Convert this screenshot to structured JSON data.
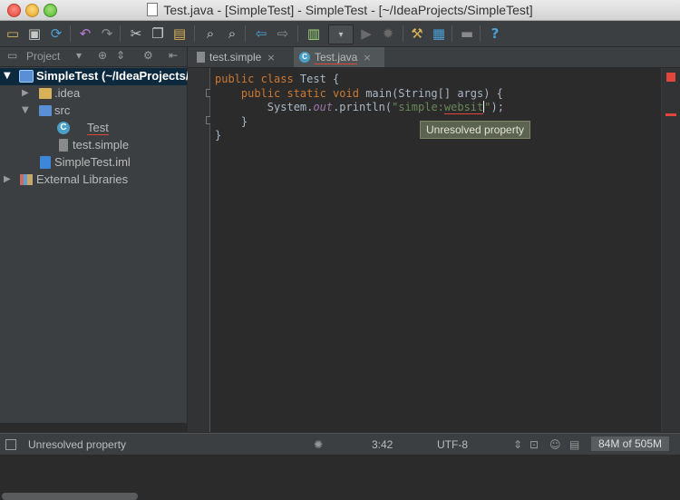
{
  "window": {
    "title": "Test.java - [SimpleTest] - SimpleTest - [~/IdeaProjects/SimpleTest]"
  },
  "toolbar": {
    "icons": [
      "open-folder-icon",
      "save-icon",
      "sync-icon",
      "back-icon",
      "forward-icon",
      "cut-icon",
      "copy-icon",
      "paste-icon",
      "find-icon",
      "replace-icon",
      "navigate-back-icon",
      "navigate-forward-icon",
      "make-icon",
      "run-config-dropdown",
      "run-icon",
      "debug-icon",
      "settings-icon",
      "project-structure-icon",
      "sdk-icon",
      "help-icon"
    ]
  },
  "project_panel": {
    "label": "Project",
    "tree": [
      {
        "label": "SimpleTest (~/IdeaProjects/",
        "icon": "module-folder-icon",
        "expanded": true,
        "selected": true
      },
      {
        "label": ".idea",
        "icon": "folder-icon",
        "expanded": false
      },
      {
        "label": "src",
        "icon": "source-folder-icon",
        "expanded": true
      },
      {
        "label": "Test",
        "icon": "class-icon"
      },
      {
        "label": "test.simple",
        "icon": "file-icon"
      },
      {
        "label": "SimpleTest.iml",
        "icon": "iml-icon"
      },
      {
        "label": "External Libraries",
        "icon": "library-icon",
        "expanded": false
      }
    ]
  },
  "editor_tabs": [
    {
      "label": "test.simple",
      "active": false,
      "close": "×"
    },
    {
      "label": "Test.java",
      "active": true,
      "close": "×"
    }
  ],
  "code": {
    "line1": {
      "kw": "public class ",
      "name": "Test {"
    },
    "line2": {
      "indent": "    ",
      "kw": "public static void ",
      "rest": "main(String[] args) {"
    },
    "line3": {
      "indent": "        ",
      "a": "System.",
      "field": "out",
      "b": ".println(",
      "str1": "\"simple:",
      "str2": "websit",
      "str3": "\"",
      "c": ");"
    },
    "line4": "    }",
    "line5": "}"
  },
  "tooltip": "Unresolved property",
  "status": {
    "message": "Unresolved property",
    "position": "3:42",
    "encoding": "UTF-8",
    "memory": "84M of 505M"
  },
  "colors": {
    "accent": "#4a9fc6",
    "error": "#e0463a",
    "selection": "#0d293e",
    "keyword": "#cc7832",
    "string": "#6a8759"
  }
}
